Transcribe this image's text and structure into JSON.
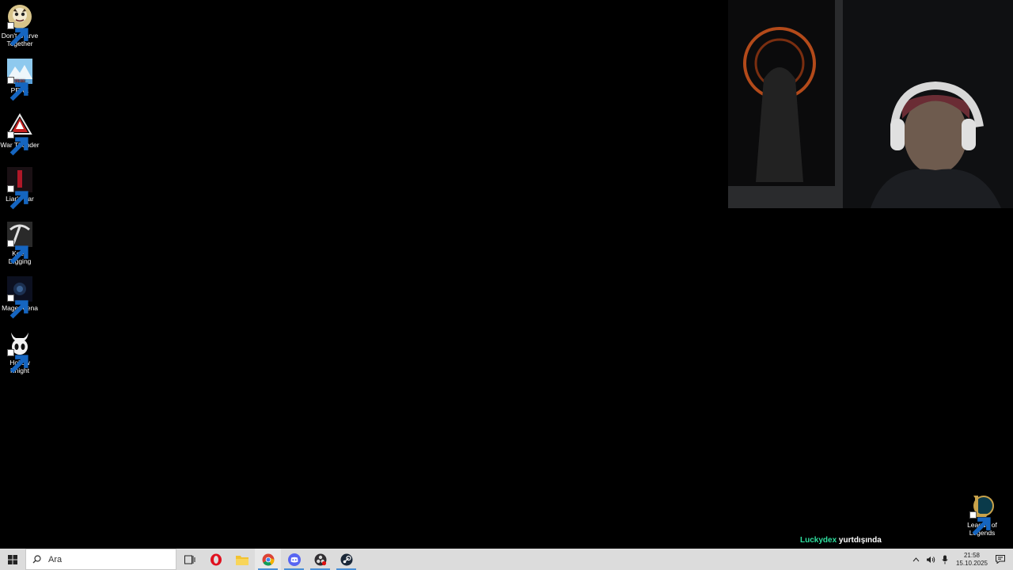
{
  "desktop": {
    "icons": [
      {
        "label": "Don't Starve Together",
        "icon": "dont-starve-together-icon"
      },
      {
        "label": "PEAK",
        "icon": "peak-icon"
      },
      {
        "label": "War Thunder",
        "icon": "war-thunder-icon"
      },
      {
        "label": "Liar's Bar",
        "icon": "liars-bar-icon"
      },
      {
        "label": "Keep Digging",
        "icon": "keep-digging-icon"
      },
      {
        "label": "Mage Arena",
        "icon": "mage-arena-icon"
      },
      {
        "label": "Hollow Knight",
        "icon": "hollow-knight-icon"
      },
      {
        "label": "League of Legends",
        "icon": "league-of-legends-icon"
      }
    ]
  },
  "overlay": {
    "username": "Luckydex",
    "message": "yurtdışında",
    "username_color": "#2fe0a0"
  },
  "taskbar": {
    "search_placeholder": "Ara",
    "apps": [
      "task-view-icon",
      "opera-icon",
      "file-explorer-icon",
      "chrome-icon",
      "discord-icon",
      "obs-icon",
      "steam-icon"
    ],
    "clock": {
      "time": "21:58",
      "date": "15.10.2025"
    },
    "accent": "#4a8fd6"
  }
}
